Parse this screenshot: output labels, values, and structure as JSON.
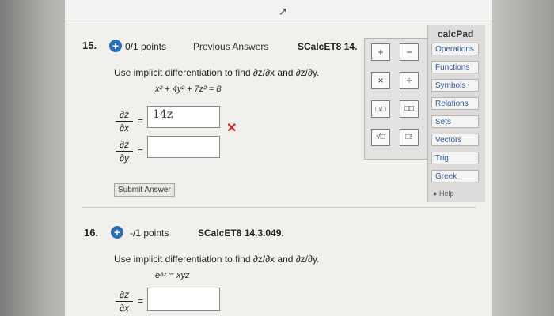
{
  "q15": {
    "number": "15.",
    "points": "0/1 points",
    "prev_answers": "Previous Answers",
    "code": "SCalcET8 14.",
    "instruction": "Use implicit differentiation to find ∂z/∂x and ∂z/∂y.",
    "equation": "x² + 4y² + 7z² = 8",
    "dzdx_value": "14z",
    "dzdy_value": "",
    "submit_label": "Submit Answer",
    "feedback_color": "#d42020"
  },
  "q16": {
    "number": "16.",
    "points": "-/1 points",
    "code": "SCalcET8 14.3.049.",
    "instruction": "Use implicit differentiation to find ∂z/∂x and ∂z/∂y.",
    "equation": "e⁸ᶻ = xyz",
    "dzdx_value": ""
  },
  "fractions": {
    "num": "∂z",
    "den_x": "∂x",
    "den_y": "∂y",
    "equals": "="
  },
  "palette": {
    "plus": "+",
    "minus": "−",
    "times": "×",
    "divide": "÷",
    "frac": "□/□",
    "power": "□□",
    "sqrt": "√□",
    "fact": "□!"
  },
  "calcpad": {
    "title": "calcPad",
    "items": [
      "Operations",
      "Functions",
      "Symbols",
      "Relations",
      "Sets",
      "Vectors",
      "Trig",
      "Greek"
    ],
    "help": "Help"
  },
  "colors": {
    "accent": "#2a6fb5",
    "link": "#2f5b9c"
  }
}
